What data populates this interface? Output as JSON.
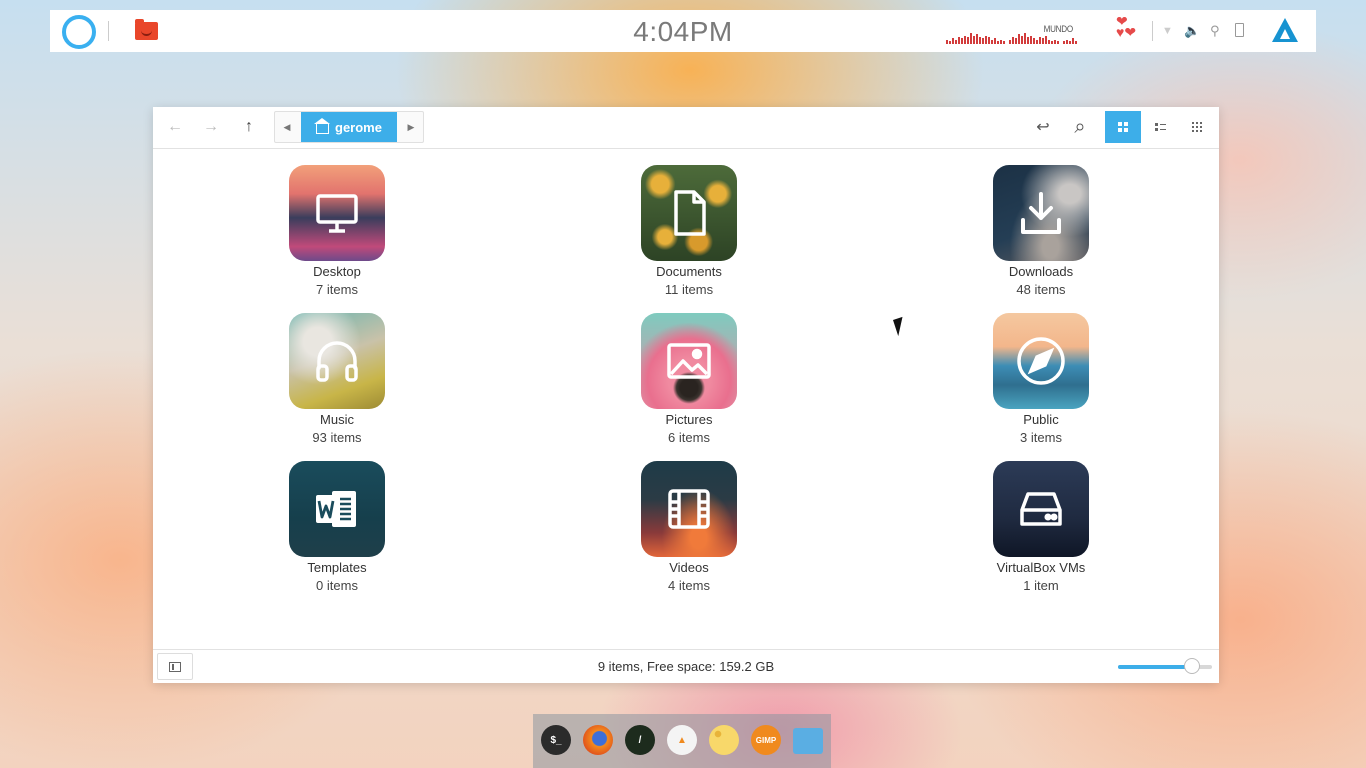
{
  "panel": {
    "clock": "4:04PM",
    "visualizer_label": "MUNDO",
    "visualizer_levels": [
      3,
      2,
      4,
      3,
      5,
      4,
      6,
      5,
      8,
      6,
      7,
      5,
      4,
      6,
      5,
      3,
      4,
      2,
      3,
      2,
      0,
      3,
      5,
      4,
      7,
      6,
      8,
      5,
      6,
      4,
      3,
      5,
      4,
      6,
      3,
      2,
      3,
      2,
      0,
      2,
      3,
      2,
      4,
      2
    ]
  },
  "window": {
    "toolbar": {
      "back_icon": "←",
      "forward_icon": "→",
      "up_icon": "↑",
      "crumb_prev": "◀",
      "crumb_next": "▶",
      "location": "gerome",
      "undo_icon": "↩",
      "search_icon": "⌕"
    },
    "items": [
      {
        "name": "Desktop",
        "count": "7 items",
        "icon": "monitor-icon",
        "bg": "linear-gradient(180deg,#f2a07a 0%,#e2736e 30%,#3a3d5c 55%,#c04a7a 85%,#6d4a8a 100%)"
      },
      {
        "name": "Documents",
        "count": "11 items",
        "icon": "document-icon",
        "bg": "radial-gradient(circle at 20% 20%,#e7b03a 8%,transparent 14%),radial-gradient(circle at 80% 30%,#e7b03a 8%,transparent 14%),radial-gradient(circle at 60% 80%,#d89a2c 9%,transparent 15%),radial-gradient(circle at 25% 75%,#e7b03a 7%,transparent 13%),linear-gradient(180deg,#4d6b3a,#2d4325)"
      },
      {
        "name": "Downloads",
        "count": "48 items",
        "icon": "download-icon",
        "bg": "radial-gradient(ellipse at 80% 30%,#c9c6c4 10%,transparent 45%),radial-gradient(ellipse at 60% 85%,#a9a29c 10%,transparent 50%),linear-gradient(160deg,#1c3145,#243e55 60%,#5b5a5e)"
      },
      {
        "name": "Music",
        "count": "93 items",
        "icon": "headphones-icon",
        "bg": "radial-gradient(ellipse at 30% 30%,#e9e6e0 15%,transparent 45%),linear-gradient(160deg,#6bb5b0 0%,#c9c2a9 45%,#c8b548 75%,#9d8b34 100%)"
      },
      {
        "name": "Pictures",
        "count": "6 items",
        "icon": "image-icon",
        "bg": "radial-gradient(circle at 50% 78%,#2a2420 10%,#3b342f 14%,transparent 18%),radial-gradient(circle at 50% 70%,#f08aa0 25%,#e96f8e 50%,transparent 70%),linear-gradient(180deg,#7ecbbf,#e98aa0)"
      },
      {
        "name": "Public",
        "count": "3 items",
        "icon": "compass-icon",
        "bg": "linear-gradient(180deg,#f4c8a0 0%,#f3b68b 35%,#3d8db5 55%,#2f6f8f 75%,#4aa4c0 100%)"
      },
      {
        "name": "Templates",
        "count": "0 items",
        "icon": "word-icon",
        "bg": "linear-gradient(180deg,#1a4c5c,#163f4c 60%,#1f3f4a)"
      },
      {
        "name": "Videos",
        "count": "4 items",
        "icon": "film-icon",
        "bg": "radial-gradient(ellipse at 60% 80%,#f07a3a 10%,transparent 45%),linear-gradient(180deg,#1e3b48 0%,#2b3b45 40%,#8a3a3a 75%,#e2663a 100%)"
      },
      {
        "name": "VirtualBox VMs",
        "count": "1 item",
        "icon": "harddrive-icon",
        "bg": "linear-gradient(180deg,#2c3b57,#1f2a40 60%,#0f1626)"
      }
    ],
    "status": {
      "text": "9 items, Free space: 159.2 GB",
      "zoom_level": 0.79
    }
  },
  "dock": {
    "apps": [
      {
        "name": "terminal-icon",
        "label": "$_",
        "bg": "#2b2b2b"
      },
      {
        "name": "firefox-icon",
        "label": "",
        "bg": "radial-gradient(circle at 55% 45%,#3d6fd8 30%,#f38a1d 34%,#e2561c 70%)"
      },
      {
        "name": "editor-icon",
        "label": "/",
        "bg": "#1d2b1d"
      },
      {
        "name": "vlc-icon",
        "label": "▲",
        "bg": "#f4f4f4"
      },
      {
        "name": "cheese-icon",
        "label": "",
        "bg": "radial-gradient(circle at 30% 30%,#e8b43a 10%,#f8d86a 12%),#f8d86a"
      },
      {
        "name": "gimp-icon",
        "label": "GIMP",
        "bg": "#f08a1e"
      },
      {
        "name": "files-icon",
        "label": "",
        "bg": "#5aaee3"
      }
    ]
  }
}
